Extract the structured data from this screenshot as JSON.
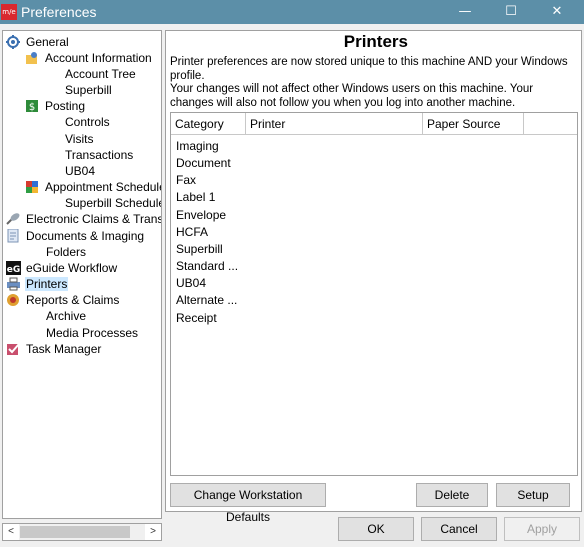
{
  "window": {
    "title": "Preferences",
    "app_icon_text": "m/e",
    "minimize_glyph": "—",
    "maximize_glyph": "☐",
    "close_glyph": "✕"
  },
  "tree": {
    "items": [
      {
        "label": "General",
        "icon": "gear-icon"
      },
      {
        "label": "Account Information",
        "icon": "account-icon"
      },
      {
        "label": "Account Tree",
        "icon": ""
      },
      {
        "label": "Superbill",
        "icon": ""
      },
      {
        "label": "Posting",
        "icon": "posting-icon"
      },
      {
        "label": "Controls",
        "icon": ""
      },
      {
        "label": "Visits",
        "icon": ""
      },
      {
        "label": "Transactions",
        "icon": ""
      },
      {
        "label": "UB04",
        "icon": ""
      },
      {
        "label": "Appointment Scheduler",
        "icon": "scheduler-icon"
      },
      {
        "label": "Superbill Scheduler",
        "icon": ""
      },
      {
        "label": "Electronic Claims & Transmis",
        "icon": "satellite-icon"
      },
      {
        "label": "Documents & Imaging",
        "icon": "document-icon"
      },
      {
        "label": "Folders",
        "icon": ""
      },
      {
        "label": "eGuide Workflow",
        "icon": "eguide-icon"
      },
      {
        "label": "Printers",
        "icon": "printer-icon"
      },
      {
        "label": "Reports & Claims",
        "icon": "reports-icon"
      },
      {
        "label": "Archive",
        "icon": ""
      },
      {
        "label": "Media Processes",
        "icon": ""
      },
      {
        "label": "Task Manager",
        "icon": "task-manager-icon"
      }
    ],
    "selected": "Printers",
    "scroll_left_glyph": "<",
    "scroll_right_glyph": ">"
  },
  "panel": {
    "title": "Printers",
    "info_line1": "Printer preferences are now stored unique to this machine AND your Windows profile.",
    "info_line2": "Your changes will not affect other Windows users on this machine.  Your changes will also not follow you when you log into another machine."
  },
  "grid": {
    "columns": [
      "Category",
      "Printer",
      "Paper Source"
    ],
    "rows": [
      "Imaging",
      "Document",
      "Fax",
      "Label 1",
      "Envelope",
      "HCFA",
      "Superbill",
      "Standard ...",
      "UB04",
      "Alternate ...",
      "Receipt"
    ]
  },
  "buttons": {
    "change_defaults": "Change Workstation Defaults",
    "delete": "Delete",
    "setup": "Setup",
    "ok": "OK",
    "cancel": "Cancel",
    "apply": "Apply"
  },
  "colors": {
    "titlebar": "#5c8fa8",
    "selection": "#cce8ff"
  }
}
